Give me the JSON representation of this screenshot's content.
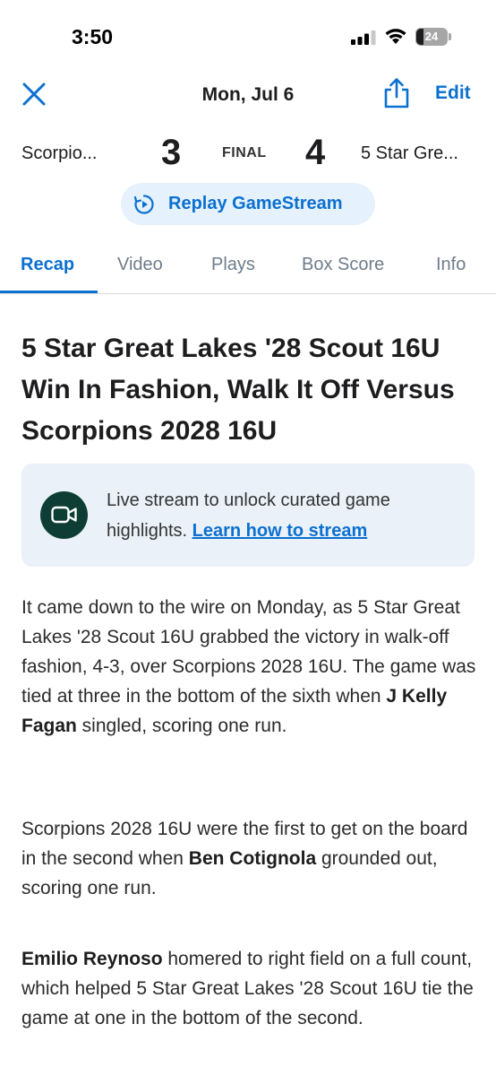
{
  "status_bar": {
    "time": "3:50",
    "battery": "24",
    "icons": [
      "signal-icon",
      "wifi-icon",
      "battery-icon"
    ]
  },
  "header": {
    "date": "Mon, Jul 6",
    "edit_label": "Edit",
    "icons": [
      "close-icon",
      "share-icon"
    ]
  },
  "scoreboard": {
    "away_team": "Scorpio...",
    "away_score": "3",
    "status": "FINAL",
    "home_score": "4",
    "home_team": "5 Star Gre..."
  },
  "replay": {
    "label": "Replay GameStream",
    "icon": "replay-icon"
  },
  "tabs": [
    {
      "label": "Recap",
      "active": true
    },
    {
      "label": "Video",
      "active": false
    },
    {
      "label": "Plays",
      "active": false
    },
    {
      "label": "Box Score",
      "active": false
    },
    {
      "label": "Info",
      "active": false
    }
  ],
  "article": {
    "headline": "5 Star Great Lakes '28 Scout 16U Win In Fashion, Walk It Off Versus Scorpions 2028 16U",
    "stream_card": {
      "text": "Live stream to unlock curated game highlights.",
      "link": "Learn how to stream",
      "icon": "video-camera-icon"
    },
    "paragraphs": [
      {
        "t1": "It came down to the wire on Monday, as 5 Star Great Lakes '28 Scout 16U grabbed the victory in walk-off fashion, 4-3, over Scorpions 2028 16U. The game was tied at three in the bottom of the sixth when ",
        "player": "J Kelly Fagan",
        "t2": " singled, scoring one run."
      },
      {
        "t1": "Scorpions 2028 16U were the first to get on the board in the second when ",
        "player": "Ben Cotignola",
        "t2": " grounded out, scoring one run."
      },
      {
        "t1": "",
        "player": "Emilio Reynoso",
        "t2": " homered to right field on a full count, which helped 5 Star Great Lakes '28 Scout 16U tie the game at one in the bottom of the second."
      }
    ]
  },
  "colors": {
    "accent": "#0b70d0",
    "replay_bg": "#e5f1fc",
    "card_bg": "#eaf1f8",
    "stream_icon_bg": "#0e3d33"
  }
}
